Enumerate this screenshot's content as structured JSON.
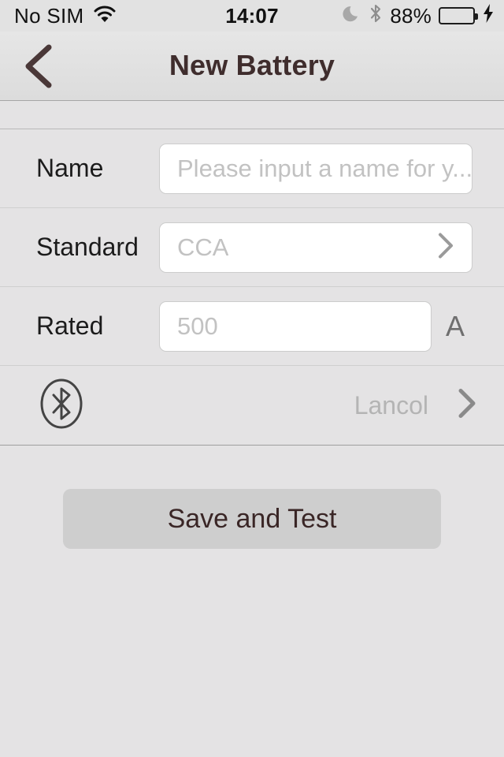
{
  "status_bar": {
    "carrier": "No SIM",
    "wifi_icon": "wifi-icon",
    "time": "14:07",
    "dnd_icon": "moon-icon",
    "bluetooth_icon": "bluetooth-icon",
    "battery_percent": "88%",
    "battery_level": 88,
    "battery_color": "#4cd964",
    "charging_icon": "lightning-bolt-icon"
  },
  "navbar": {
    "title": "New Battery",
    "back_icon": "chevron-left-icon",
    "title_color": "#3f2d2d"
  },
  "form": {
    "rows": [
      {
        "label": "Name",
        "placeholder": "Please input a name for y...",
        "value": "",
        "has_chevron": false,
        "unit": ""
      },
      {
        "label": "Standard",
        "placeholder": "CCA",
        "value": "",
        "has_chevron": true,
        "unit": ""
      },
      {
        "label": "Rated",
        "placeholder": "500",
        "value": "",
        "has_chevron": false,
        "unit": "A"
      }
    ],
    "bluetooth_row": {
      "icon": "bluetooth-circle-icon",
      "device_name": "Lancol",
      "chevron_icon": "chevron-right-icon"
    }
  },
  "actions": {
    "save_and_test_label": "Save and Test"
  },
  "colors": {
    "page_background": "#e4e3e4",
    "navbar_background": "#e1e1e1",
    "field_background": "#ffffff",
    "field_border": "#cccccc",
    "placeholder_text": "#c2c2c2",
    "label_text": "#1b1b1b",
    "accent_maroon": "#3f2d2d",
    "button_background": "#cecece",
    "chevron_gray": "#9a9a9a"
  }
}
